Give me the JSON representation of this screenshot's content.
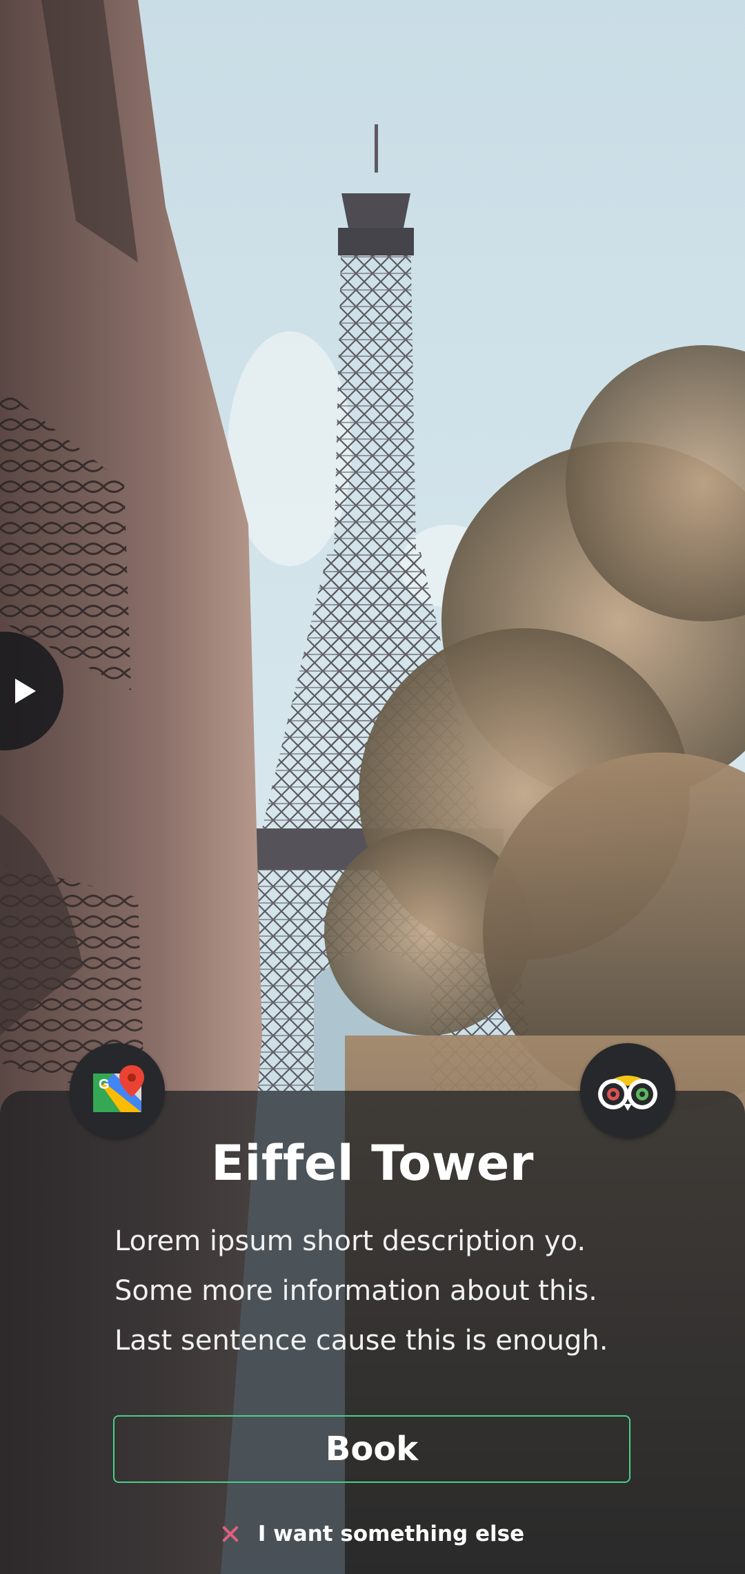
{
  "place": {
    "title": "Eiffel Tower",
    "description_lines": [
      "Lorem ipsum short description yo.",
      "Some more information about this.",
      "Last sentence cause this is enough."
    ]
  },
  "actions": {
    "book_label": "Book",
    "alternative_label": "I want something else"
  },
  "icons": {
    "play": "play-icon",
    "maps": "google-maps-icon",
    "tripadvisor": "tripadvisor-owl-icon",
    "dismiss": "close-icon"
  },
  "colors": {
    "accent_border": "#48d08a",
    "dismiss_icon": "#e0607a",
    "panel_overlay": "#1c1e22",
    "text": "#ffffff"
  }
}
